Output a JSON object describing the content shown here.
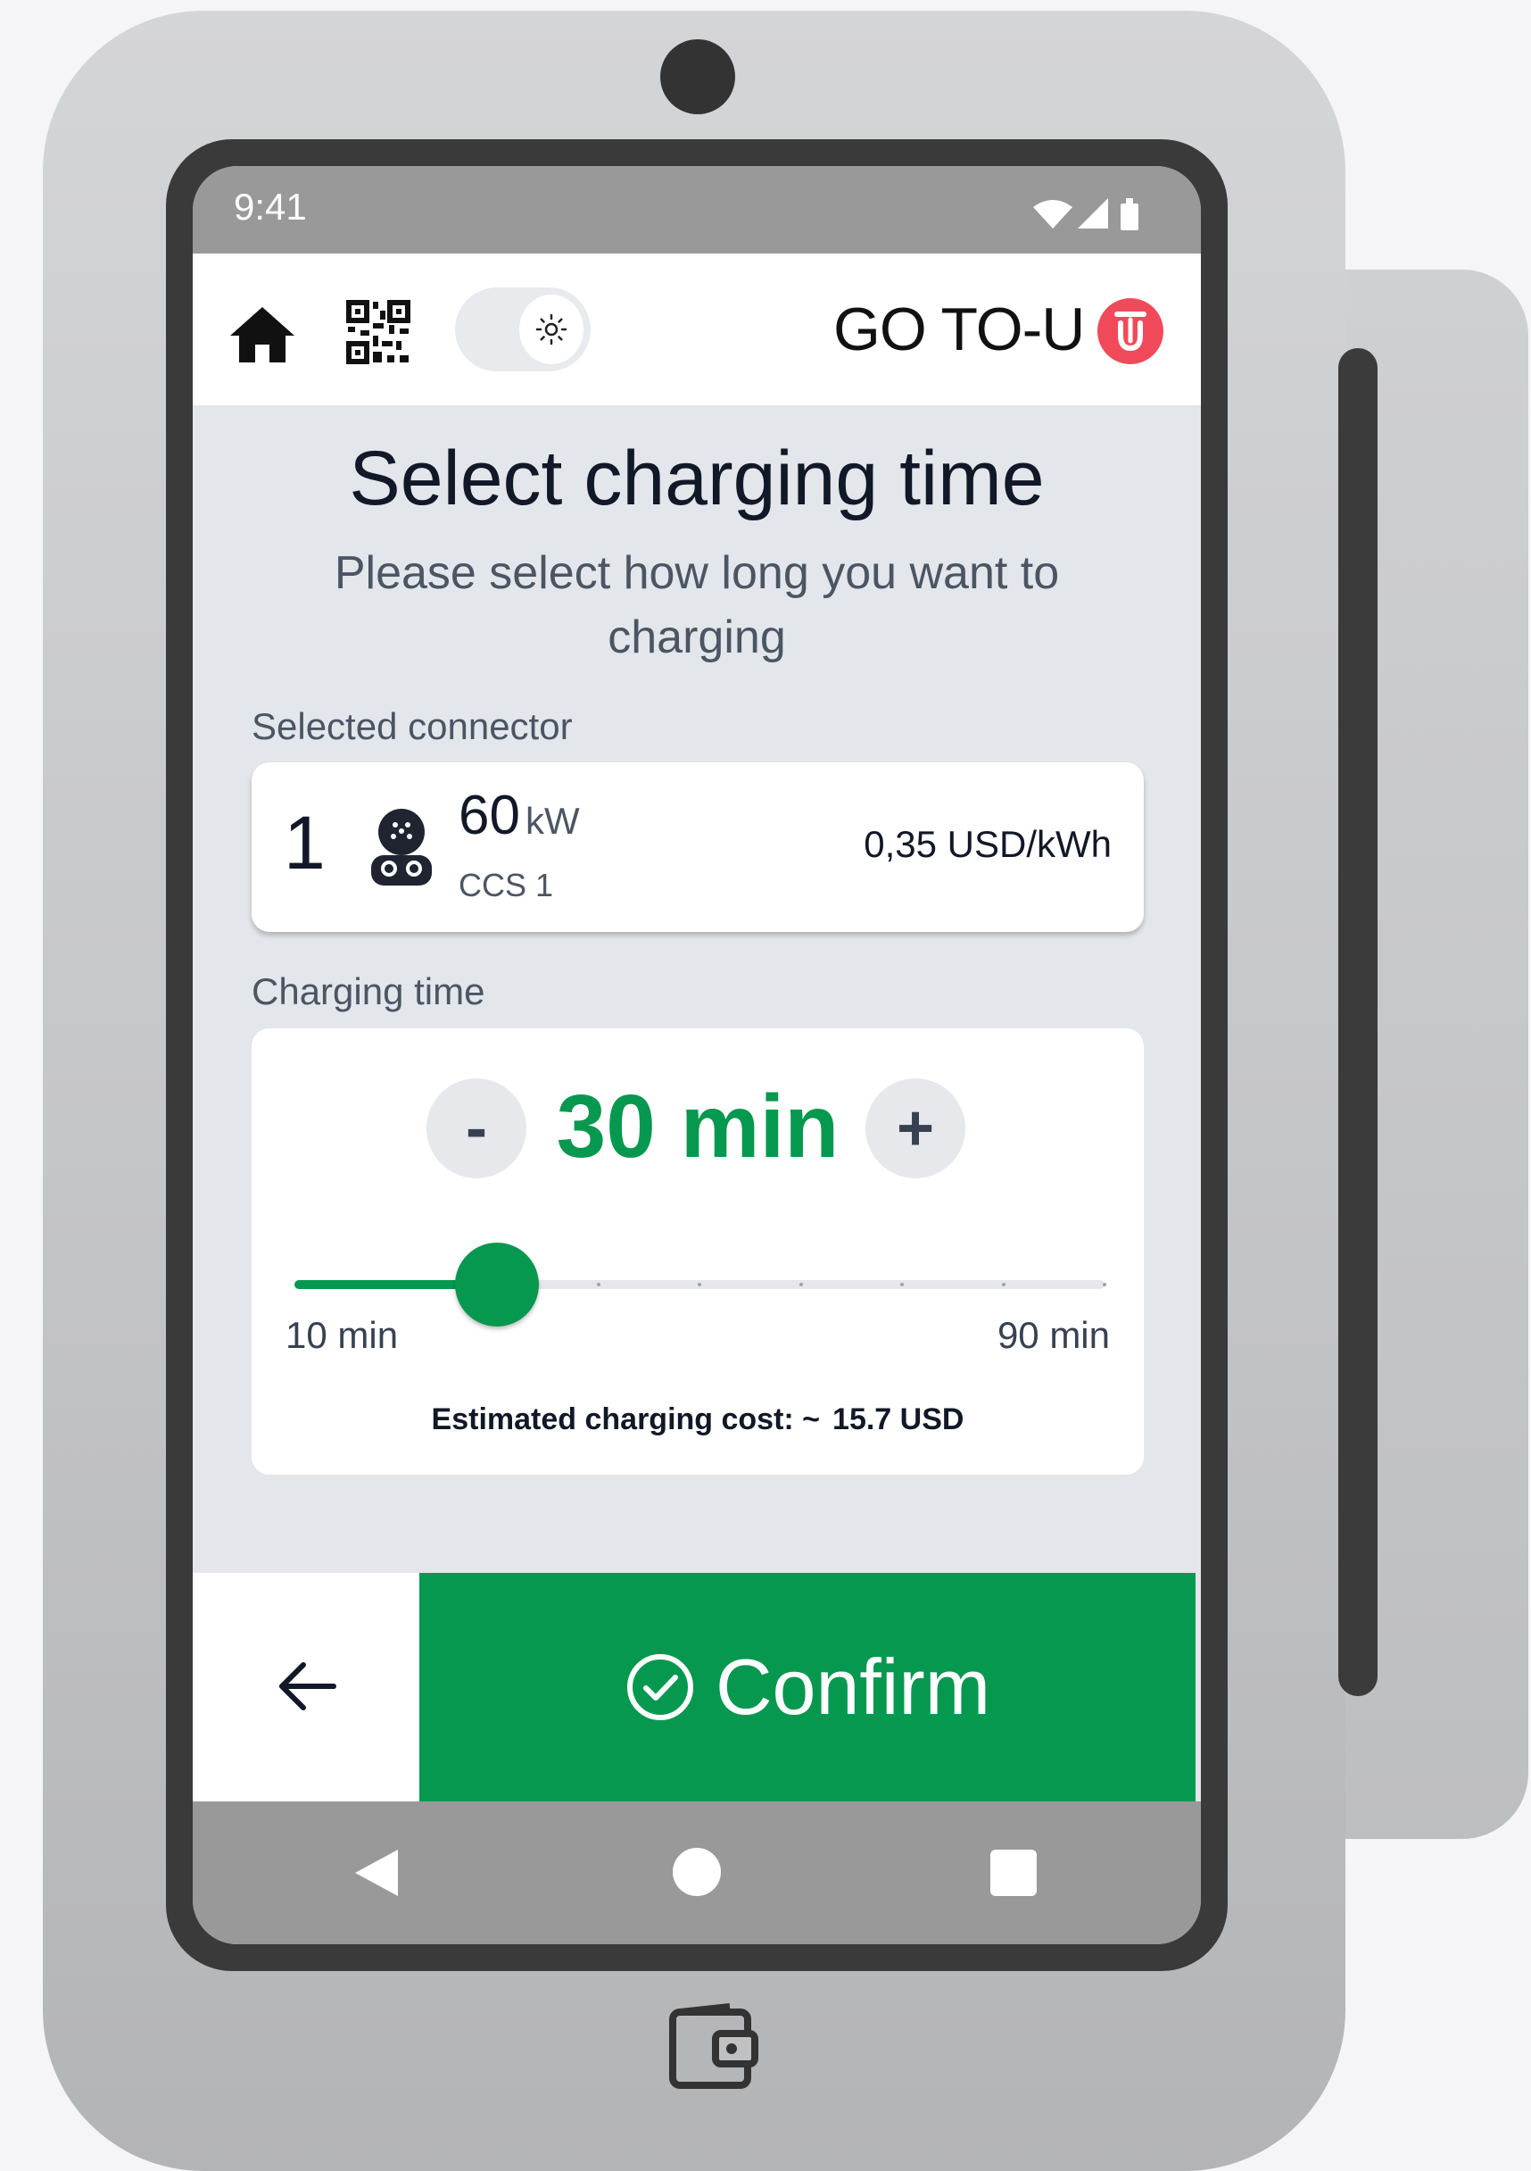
{
  "status_bar": {
    "time": "9:41",
    "icons": [
      "wifi-icon",
      "signal-icon",
      "battery-icon"
    ]
  },
  "header": {
    "brand_text": "GO TO-U",
    "brand_logo_letter": "U",
    "icons": [
      "home-icon",
      "qr-code-icon",
      "sun-icon"
    ],
    "theme_toggle": "light"
  },
  "page": {
    "title": "Select charging time",
    "subtitle": "Please select how long you want to charging"
  },
  "connector_section": {
    "label": "Selected connector",
    "number": "1",
    "power_value": "60",
    "power_unit": "kW",
    "type": "CCS 1",
    "price": "0,35 USD/kWh",
    "icon": "ccs-plug-icon"
  },
  "charging_time": {
    "label": "Charging time",
    "minus_label": "-",
    "plus_label": "+",
    "value": "30 min",
    "slider": {
      "min": 10,
      "max": 90,
      "step": 10,
      "value": 30,
      "min_label": "10 min",
      "max_label": "90 min"
    },
    "cost_label": "Estimated charging cost: ~",
    "cost_value": "15.7 USD"
  },
  "actions": {
    "back_icon": "arrow-left-icon",
    "confirm_label": "Confirm",
    "confirm_icon": "check-circle-icon"
  },
  "colors": {
    "accent": "#07984f",
    "brand_red": "#f04a5a",
    "screen_bg": "#e3e6ea",
    "system_bar": "#999999"
  }
}
